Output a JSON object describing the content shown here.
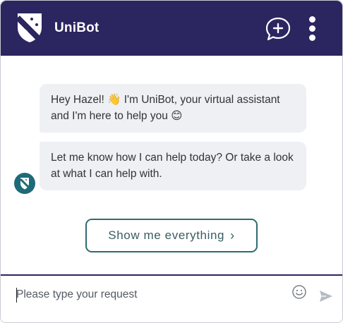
{
  "header": {
    "app_name": "UniBot"
  },
  "conversation": {
    "messages": [
      {
        "sender": "bot",
        "text": "Hey Hazel! 👋 I'm UniBot, your virtual assistant and I'm here to help you 😊"
      },
      {
        "sender": "bot",
        "text": "Let me know how I can help today? Or take a look at what I can help with."
      }
    ],
    "suggestion_label": "Show me everything"
  },
  "composer": {
    "placeholder": "Please type your request",
    "value": ""
  },
  "icons": {
    "logo": "university-crest-icon",
    "new_chat": "new-chat-icon",
    "menu": "kebab-menu-icon",
    "avatar": "bot-avatar-icon",
    "emoji": "emoji-icon",
    "send": "send-icon"
  },
  "colors": {
    "header_bg": "#2b2560",
    "bubble_bg": "#eef0f4",
    "accent": "#2e6b73"
  }
}
